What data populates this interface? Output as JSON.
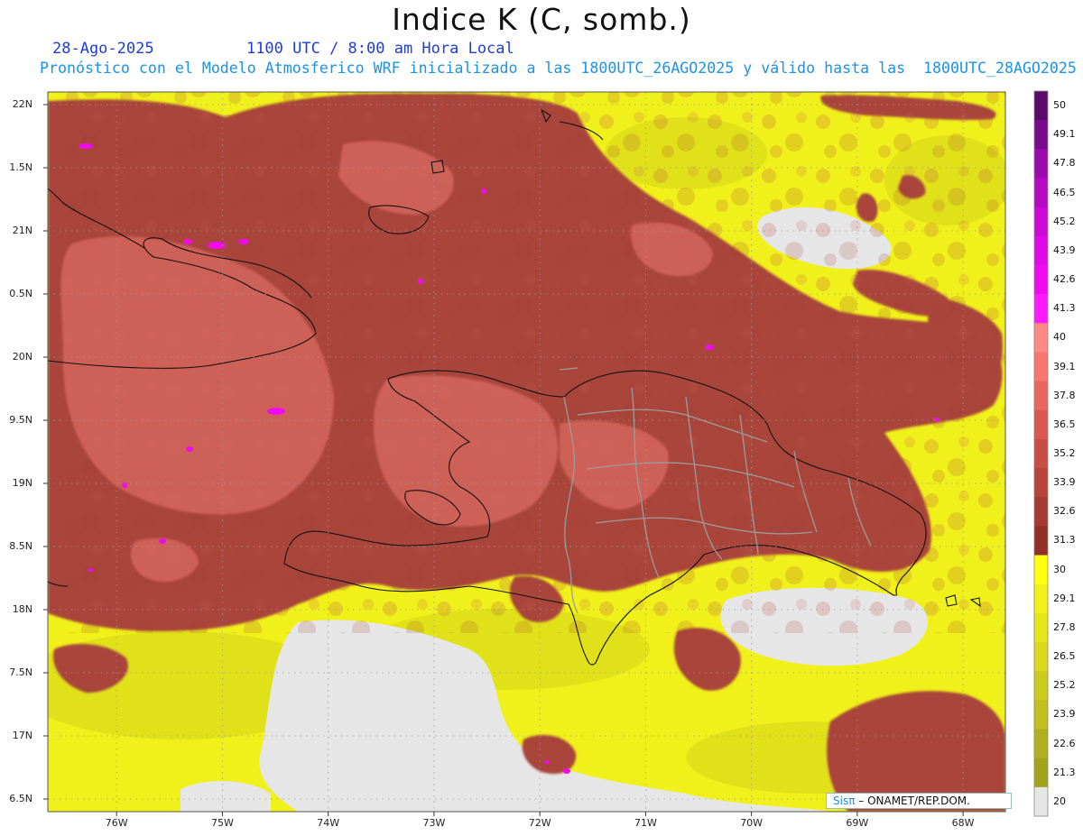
{
  "header": {
    "title": "Indice K (C, somb.)",
    "date": "28-Ago-2025",
    "time": "1100 UTC / 8:00 am Hora Local",
    "forecast_line": "Pronóstico con el Modelo Atmosferico WRF inicializado a las 1800UTC_26AGO2025 y válido hasta las  1800UTC_28AGO2025"
  },
  "axes": {
    "lat_labels": [
      "22N",
      "1.5N",
      "21N",
      "0.5N",
      "20N",
      "9.5N",
      "19N",
      "8.5N",
      "18N",
      "7.5N",
      "17N",
      "6.5N"
    ],
    "lon_labels": [
      "76W",
      "75W",
      "74W",
      "73W",
      "72W",
      "71W",
      "70W",
      "69W",
      "68W"
    ],
    "lat_values": [
      22,
      21.5,
      21,
      20.5,
      20,
      19.5,
      19,
      18.5,
      18,
      17.5,
      17,
      16.5
    ],
    "lon_values": [
      -76,
      -75,
      -74,
      -73,
      -72,
      -71,
      -70,
      -69,
      -68
    ],
    "lat_range": [
      16.4,
      22.1
    ],
    "lon_range": [
      -76.65,
      -67.6
    ],
    "grid": "dotted"
  },
  "colorbar": {
    "labels": [
      "50",
      "49.1",
      "47.8",
      "46.5",
      "45.2",
      "43.9",
      "42.6",
      "41.3",
      "40",
      "39.1",
      "37.8",
      "36.5",
      "35.2",
      "33.9",
      "32.6",
      "31.3",
      "30",
      "29.1",
      "27.8",
      "26.5",
      "25.2",
      "23.9",
      "22.6",
      "21.3",
      "20"
    ],
    "colors": [
      "#5c0a6a",
      "#780a8c",
      "#9a0aad",
      "#b40ac4",
      "#cc0ad6",
      "#e00ae6",
      "#f00af2",
      "#ff1aff",
      "#ff8a84",
      "#f77770",
      "#e9675f",
      "#d9584f",
      "#c84d44",
      "#b7433a",
      "#a53a31",
      "#913027",
      "#ffff10",
      "#f2f218",
      "#e6e61b",
      "#d9da1d",
      "#cccc1f",
      "#bfbf1f",
      "#b0b01e",
      "#a3a31c",
      "#e6e6e6"
    ]
  },
  "legend_colors": {
    "no_data": "#e6e6e6",
    "low_k": "#f0f01a",
    "mid_k": "#a9453a",
    "high_k": "#d5665d",
    "very_high_k": "#f00af2"
  },
  "credit": {
    "brand": "Sisπ",
    "text": " – ONAMET/REP.DOM."
  }
}
